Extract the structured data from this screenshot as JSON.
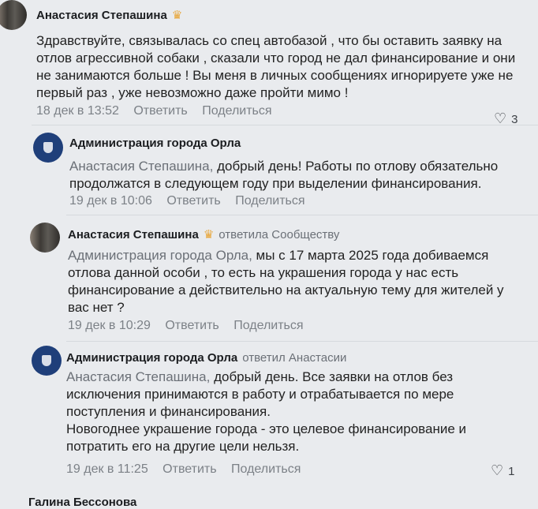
{
  "comments": [
    {
      "author": "Анастасия Степашина",
      "crown_icon": "crown-icon",
      "text": "Здравствуйте, связывалась со спец автобазой , что бы оставить заявку на отлов агрессивной собаки , сказали что город не дал финансирование и они не занимаются больше ! Вы меня в личных сообщениях игнорируете уже не первый раз , уже невозможно даже пройти мимо !",
      "date": "18 дек в 13:52",
      "reply_label": "Ответить",
      "share_label": "Поделиться",
      "likes": "3"
    },
    {
      "author": "Администрация города Орла",
      "mention": "Анастасия Степашина,",
      "text": " добрый день! Работы по отлову обязательно продолжатся в следующем году при выделении финансирования.",
      "date": "19 дек в 10:06",
      "reply_label": "Ответить",
      "share_label": "Поделиться"
    },
    {
      "author": "Анастасия Степашина",
      "reply_to": "ответила Сообществу",
      "mention": "Администрация города Орла,",
      "text": " мы с 17 марта 2025 года добиваемся отлова данной особи , то есть на украшения города у нас есть финансирование а действительно на актуальную тему для жителей у вас нет ?",
      "date": "19 дек в 10:29",
      "reply_label": "Ответить",
      "share_label": "Поделиться"
    },
    {
      "author": "Администрация города Орла",
      "reply_to": "ответил Анастасии",
      "mention": "Анастасия Степашина,",
      "text": " добрый день. Все заявки на отлов без исключения принимаются в работу и отрабатывается по мере поступления и финансирования.",
      "text2": "Новогоднее украшение города - это целевое финансирование и потратить его на другие цели нельзя.",
      "date": "19 дек в 11:25",
      "reply_label": "Ответить",
      "share_label": "Поделиться",
      "likes": "1"
    }
  ],
  "next_author_partial": "Галина Бессонова"
}
